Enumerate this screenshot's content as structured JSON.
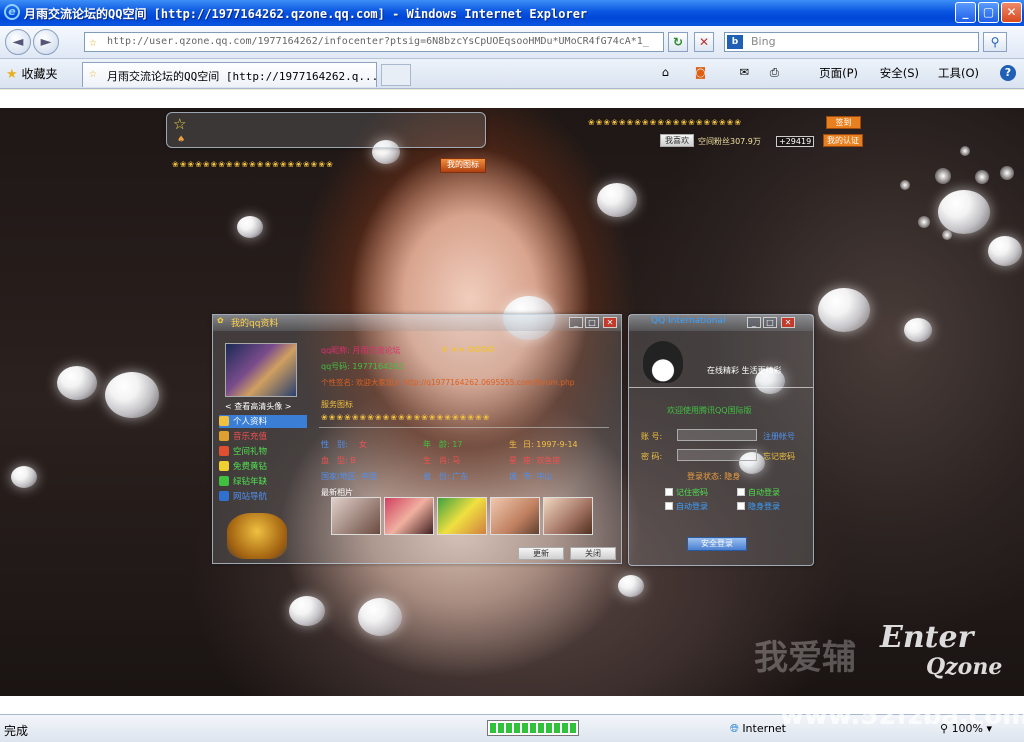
{
  "window": {
    "title": "月雨交流论坛的QQ空间 [http://1977164262.qzone.qq.com] - Windows Internet Explorer",
    "min": "_",
    "max": "▢",
    "close": "✕"
  },
  "addressbar": {
    "back": "◄",
    "forward": "►",
    "url": "http://user.qzone.qq.com/1977164262/infocenter?ptsig=6N8bzcYsCpUOEqsooHMDu*UMoCR4fG74cA*1_",
    "refresh": "↻",
    "stop": "✕",
    "search_engine": "Bing",
    "search_placeholder": "Bing"
  },
  "tabs": {
    "favorites_label": "收藏夹",
    "active_tab": "月雨交流论坛的QQ空间 [http://1977164262.q...",
    "commands": {
      "home": "⌂",
      "feeds": "◙",
      "mail": "✉",
      "print": "⎙",
      "page": "页面(P)",
      "safety": "安全(S)",
      "tools": "工具(O)",
      "help": "?"
    }
  },
  "topright": {
    "fans_label": "我喜欢",
    "fans_text": "空间粉丝307.9万",
    "count": "+29419",
    "buttons": [
      "签到",
      "我的认证"
    ]
  },
  "header_strip": {
    "mybadge": "我的图标"
  },
  "profile": {
    "panel_title": "我的qq资料",
    "view_avatar": "< 查看高清头像 >",
    "menu": [
      "个人资料",
      "音乐充值",
      "空间礼物",
      "免费黄钻",
      "绿钻年缺",
      "网站导航"
    ],
    "nickname": "qq昵称: 月雨交流论坛",
    "qq_number": "qq号码: 1977164262",
    "signature": "个性签名: 欢迎大家加入 http://q1977164262.0695555.com/forum.php",
    "level_label": "等级",
    "service_label": "服务图标",
    "stats": [
      [
        "性",
        "别:",
        "女",
        "年",
        "龄: 17",
        "生",
        "日: 1997-9-14"
      ],
      [
        "血",
        "型: B",
        "生",
        "肖: 马",
        "星",
        "座: 双鱼座"
      ],
      [
        "国家/地区: 中国",
        "省",
        "份: 广东",
        "城",
        "市: 中山"
      ]
    ],
    "latest_photos": "最新相片",
    "buttons": {
      "update": "更新",
      "close": "关闭"
    }
  },
  "login": {
    "panel_title": "QQ International",
    "tagline": "在线精彩 生活更精彩",
    "welcome": "欢迎使用腾讯QQ国际版",
    "account_label": "账  号:",
    "password_label": "密  码:",
    "register": "注册帐号",
    "forgot": "忘记密码",
    "status": "登录状态: 隐身",
    "options": [
      "记住密码",
      "自动登录",
      "自动登录",
      "隐身登录"
    ],
    "login_button": "安全登录"
  },
  "watermark": {
    "cn": "我爱辅",
    "logo_top": "Enter",
    "logo_bottom": "Qzone",
    "site": "www.52fzba.com"
  },
  "statusbar": {
    "status": "完成",
    "progress": 1.0,
    "zone": "Internet",
    "zoom": "100%"
  }
}
